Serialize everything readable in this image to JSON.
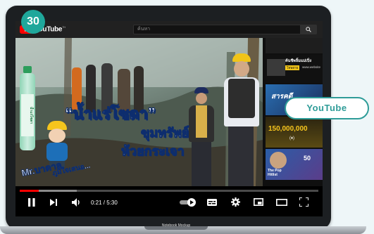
{
  "badge": {
    "number": "30"
  },
  "callout": {
    "label": "YouTube"
  },
  "header": {
    "logo_text": "YouTube",
    "logo_superscript": "TH",
    "search_placeholder": "ค้นหา"
  },
  "video": {
    "title_quoted": "“น้ำแร่โซดา”",
    "title_line2": "ขุมทรัพย์",
    "title_line3": "ห้วยกระเจา",
    "presenter_text": "Mr.บาดาล",
    "presenter_sub": "ภูมิใจเสนอ...",
    "bottle_brand": "น้ำแร่โซดา"
  },
  "sidebar": {
    "items": [
      {
        "title": "ค้นชีพลิ้มแม่เปิ่ง",
        "tag": "โทษยาย",
        "extra": "www.website"
      },
      {
        "title": "สารคดี"
      },
      {
        "count": "150,000,000",
        "tag": "(♦)"
      },
      {
        "title": "The Pop Hitlist",
        "count": "50"
      }
    ]
  },
  "player": {
    "current_time": "0:21",
    "duration": "5:30",
    "time_display": "0:21 / 5:30",
    "progress_fraction": 0.064,
    "buffer_fraction": 0.19
  },
  "device": {
    "label": "Notebook Mockup"
  },
  "colors": {
    "accent": "#1fa79b",
    "youtube_red": "#ff0000",
    "callout_border": "#2e9c98"
  }
}
